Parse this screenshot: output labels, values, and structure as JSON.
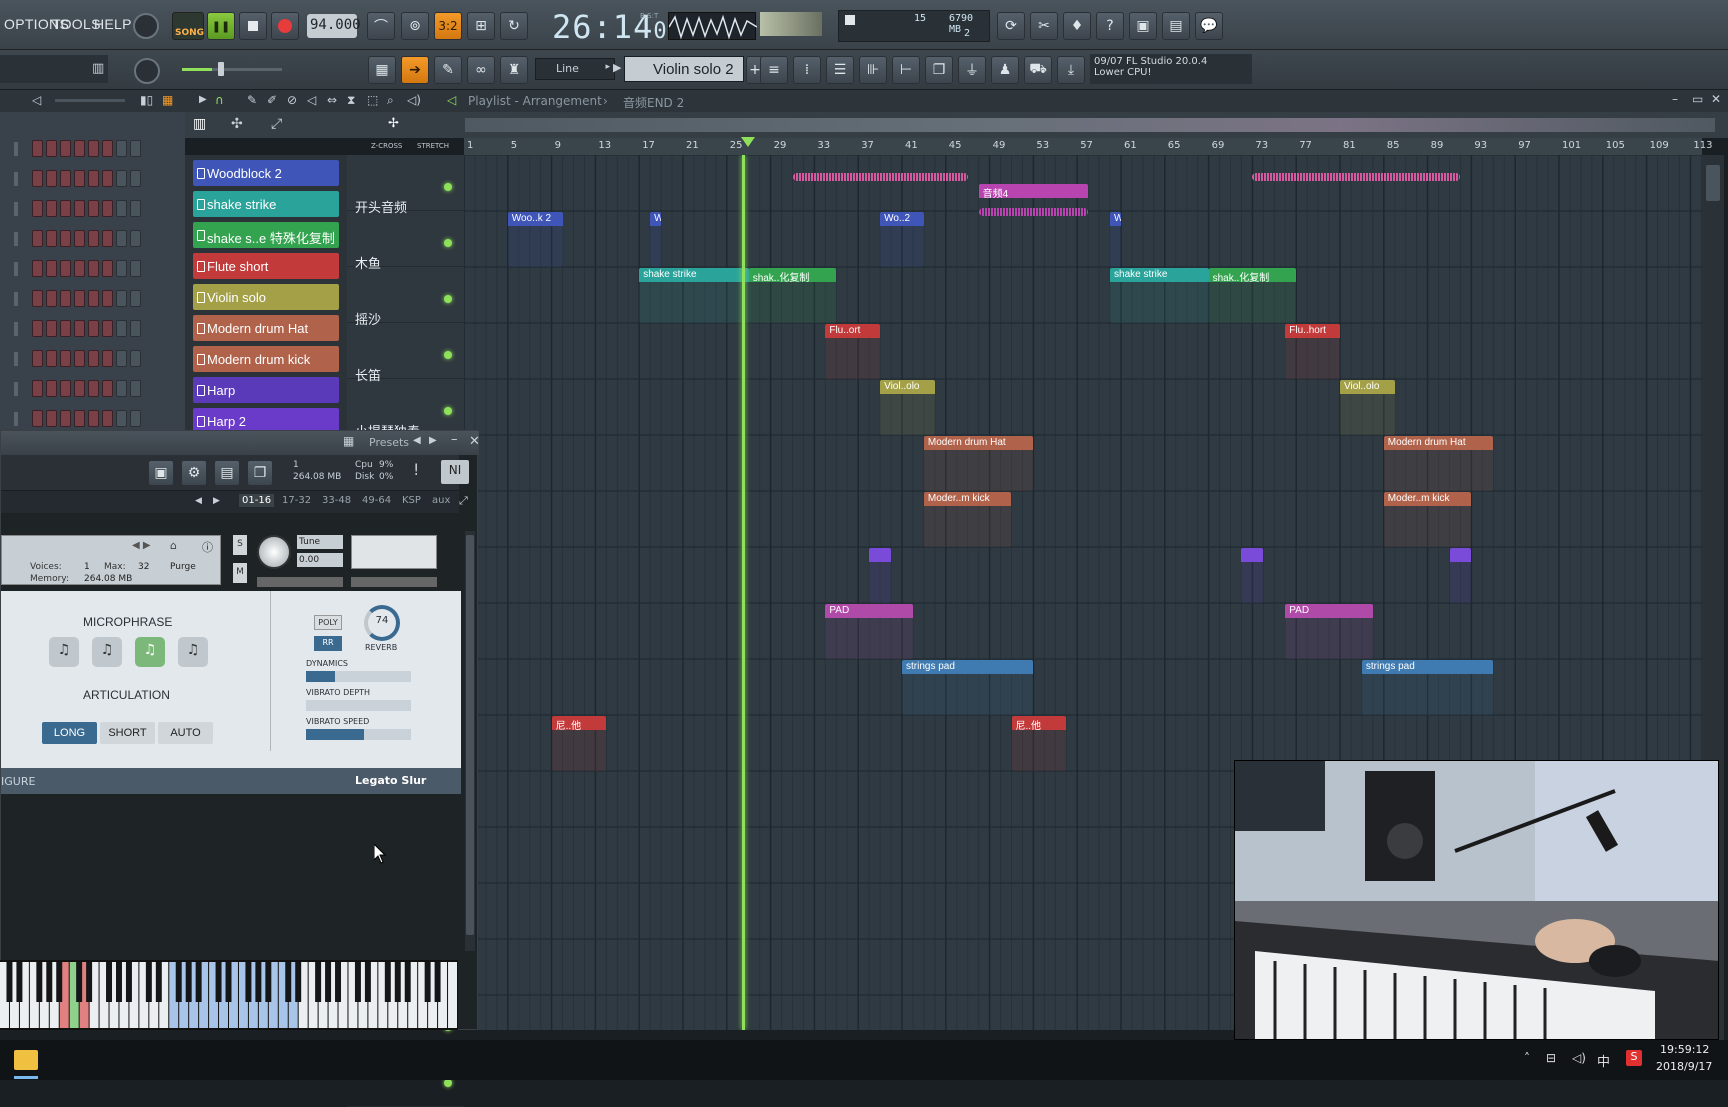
{
  "menu": {
    "options": "OPTIONS",
    "tools": "TOOLS",
    "help": "HELP"
  },
  "transport": {
    "song_label": "SONG",
    "tempo": "94.000",
    "time_main": "26:14",
    "time_sub": "01",
    "time_unit": "B:S:T"
  },
  "monitor": {
    "cpu_value": "15",
    "memory": "6790 MB",
    "polyphony": "2"
  },
  "toolbar2": {
    "snap_mode": "Line",
    "pattern_name": "Violin solo 2",
    "hint_line1": "09/07  FL Studio 20.0.4",
    "hint_line2": "Lower CPU!"
  },
  "playlist": {
    "title": "Playlist - Arrangement",
    "arrangement_name": "音频END 2",
    "zcross_label": "Z-CROSS",
    "stretch_label": "STRETCH",
    "ruler_marks": [
      "1",
      "5",
      "9",
      "13",
      "17",
      "21",
      "25",
      "29",
      "33",
      "37",
      "41",
      "45",
      "49",
      "53",
      "57",
      "61",
      "65",
      "69",
      "73",
      "77",
      "81",
      "85",
      "89",
      "93",
      "97",
      "101",
      "105",
      "109",
      "113"
    ],
    "tracks": [
      "开头音频",
      "木鱼",
      "摇沙",
      "长笛",
      "小提琴独奏"
    ]
  },
  "picker": {
    "items": [
      {
        "label": "Woodblock 2",
        "color": "#3f55b8"
      },
      {
        "label": "shake strike",
        "color": "#2aa39a"
      },
      {
        "label": "shake s..e 特殊化复制",
        "color": "#33a34f"
      },
      {
        "label": "Flute short",
        "color": "#c23a3a"
      },
      {
        "label": "Violin solo",
        "color": "#a3a048"
      },
      {
        "label": "Modern drum Hat",
        "color": "#b0624a"
      },
      {
        "label": "Modern drum kick",
        "color": "#b0624a"
      },
      {
        "label": "Harp",
        "color": "#5a3ab8"
      },
      {
        "label": "Harp 2",
        "color": "#6a3ac8"
      }
    ]
  },
  "clips": [
    {
      "label": "",
      "color": "#d65aa0"
    },
    {
      "label": "音频4",
      "color": "#b844b0"
    },
    {
      "label": "Woo..k 2",
      "color": "#3f55b8"
    },
    {
      "label": "Wo..2",
      "color": "#3f55b8"
    },
    {
      "label": "shake strike",
      "color": "#2aa39a"
    },
    {
      "label": "shak..化复制",
      "color": "#33a34f"
    },
    {
      "label": "Flu..ort",
      "color": "#c23a3a"
    },
    {
      "label": "Flu..hort",
      "color": "#c23a3a"
    },
    {
      "label": "Viol..olo",
      "color": "#a3a048"
    },
    {
      "label": "Modern drum Hat",
      "color": "#b0624a"
    },
    {
      "label": "Moder..m kick",
      "color": "#b0624a"
    },
    {
      "label": "PAD",
      "color": "#b04aa8"
    },
    {
      "label": "strings pad",
      "color": "#3f7ab0"
    },
    {
      "label": "尼..他",
      "color": "#c23a3a"
    }
  ],
  "plugin": {
    "presets_label": "Presets",
    "instances": "1",
    "memory_total": "264.08 MB",
    "cpu_label": "Cpu",
    "cpu_value": "9%",
    "disk_label": "Disk",
    "disk_value": "0%",
    "tabs": [
      "01-16",
      "17-32",
      "33-48",
      "49-64",
      "KSP",
      "aux"
    ],
    "voices_label": "Voices:",
    "voices_value": "1",
    "max_label": "Max:",
    "max_value": "32",
    "purge_label": "Purge",
    "memory_label": "Memory:",
    "memory_value": "264.08 MB",
    "tune_label": "Tune",
    "tune_value": "0.00",
    "microphrase_label": "MICROPHRASE",
    "articulation_label": "ARTICULATION",
    "art_long": "LONG",
    "art_short": "SHORT",
    "art_auto": "AUTO",
    "poly_label": "POLY",
    "rr_label": "RR",
    "reverb_value": "74",
    "reverb_label": "REVERB",
    "dynamics_label": "DYNAMICS",
    "dynamics_level": 0.28,
    "vibrato_depth_label": "VIBRATO DEPTH",
    "vibrato_depth_level": 0.0,
    "vibrato_speed_label": "VIBRATO SPEED",
    "vibrato_speed_level": 0.55,
    "footer_left": "IGURE",
    "footer_right": "Legato Slur"
  },
  "taskbar": {
    "time": "19:59:12",
    "date": "2018/9/17",
    "ime": "中"
  },
  "colors": {
    "playhead": "#8fe05a",
    "accent_orange": "#f49a2a",
    "grid_bg": "#2f3a42"
  }
}
